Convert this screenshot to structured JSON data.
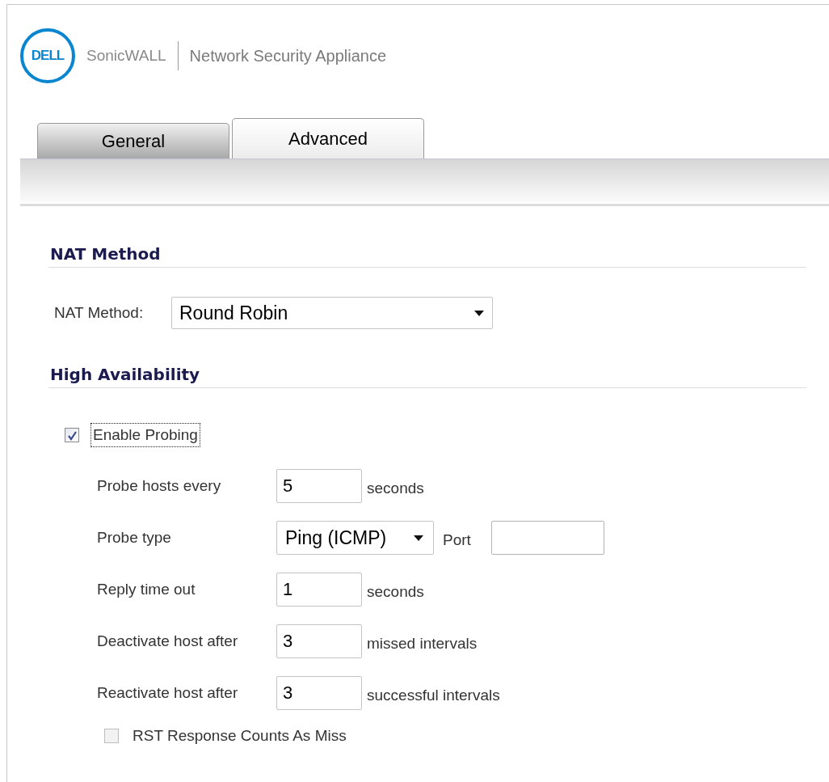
{
  "header": {
    "logo_text": "DELL",
    "brand": "SonicWALL",
    "product": "Network Security Appliance"
  },
  "tabs": [
    {
      "label": "General",
      "selected": false
    },
    {
      "label": "Advanced",
      "selected": true
    }
  ],
  "sections": [
    {
      "title": "NAT Method",
      "fields": [
        {
          "kind": "select",
          "label": "NAT Method:",
          "value": "Round Robin"
        }
      ]
    },
    {
      "title": "High Availability",
      "fields": [
        {
          "kind": "checkbox",
          "label": "Enable Probing",
          "checked": true,
          "focused": true
        },
        {
          "kind": "number",
          "label": "Probe hosts every",
          "value": "5",
          "unit": "seconds"
        },
        {
          "kind": "probe_type",
          "label": "Probe type",
          "value": "Ping (ICMP)",
          "port_label": "Port"
        },
        {
          "kind": "number",
          "label": "Reply time out",
          "value": "1",
          "unit": "seconds"
        },
        {
          "kind": "number",
          "label": "Deactivate host after",
          "value": "3",
          "unit": "missed intervals"
        },
        {
          "kind": "number",
          "label": "Reactivate host after",
          "value": "3",
          "unit": "successful intervals"
        },
        {
          "kind": "checkbox",
          "label": "RST Response Counts As Miss",
          "checked": false,
          "disabled": true,
          "focused": false
        }
      ]
    }
  ]
}
